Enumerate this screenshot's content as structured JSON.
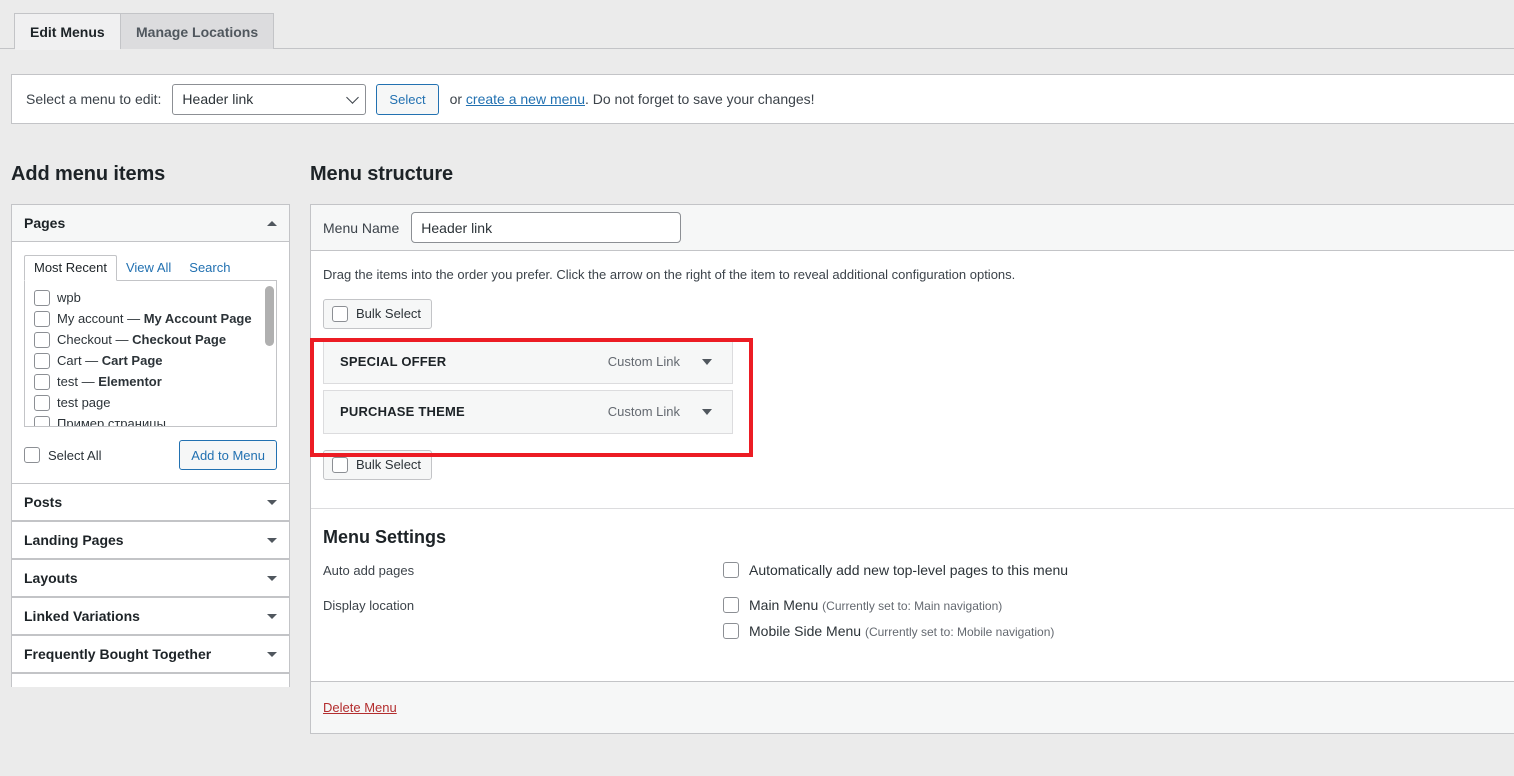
{
  "tabs": [
    {
      "label": "Edit Menus",
      "active": true
    },
    {
      "label": "Manage Locations",
      "active": false
    }
  ],
  "menu_selector": {
    "label": "Select a menu to edit:",
    "selected": "Header link",
    "options": [
      "Header link"
    ],
    "select_button": "Select",
    "or_text": "or ",
    "create_link": "create a new menu",
    "after_text": ". Do not forget to save your changes!"
  },
  "left": {
    "heading": "Add menu items",
    "pages_panel": {
      "title": "Pages",
      "tabs": [
        {
          "label": "Most Recent",
          "active": true
        },
        {
          "label": "View All",
          "active": false
        },
        {
          "label": "Search",
          "active": false
        }
      ],
      "items": [
        {
          "name": "wpb",
          "type": ""
        },
        {
          "name": "My account",
          "type": "My Account Page"
        },
        {
          "name": "Checkout",
          "type": "Checkout Page"
        },
        {
          "name": "Cart",
          "type": "Cart Page"
        },
        {
          "name": "test",
          "type": "Elementor"
        },
        {
          "name": "test page",
          "type": ""
        },
        {
          "name": "Пример страницы",
          "type": ""
        }
      ],
      "select_all": "Select All",
      "add_to_menu": "Add to Menu"
    },
    "sections": [
      {
        "title": "Posts"
      },
      {
        "title": "Landing Pages"
      },
      {
        "title": "Layouts"
      },
      {
        "title": "Linked Variations"
      },
      {
        "title": "Frequently Bought Together"
      }
    ]
  },
  "right": {
    "heading": "Menu structure",
    "menu_name_label": "Menu Name",
    "menu_name_value": "Header link",
    "hint": "Drag the items into the order you prefer. Click the arrow on the right of the item to reveal additional configuration options.",
    "bulk_select_top": "Bulk Select",
    "bulk_select_bottom": "Bulk Select",
    "menu_items": [
      {
        "title": "SPECIAL OFFER",
        "type": "Custom Link"
      },
      {
        "title": "PURCHASE THEME",
        "type": "Custom Link"
      }
    ],
    "settings": {
      "heading": "Menu Settings",
      "auto_add_label": "Auto add pages",
      "auto_add_option": "Automatically add new top-level pages to this menu",
      "display_location_label": "Display location",
      "locations": [
        {
          "name": "Main Menu",
          "note": "(Currently set to: Main navigation)"
        },
        {
          "name": "Mobile Side Menu",
          "note": "(Currently set to: Mobile navigation)"
        }
      ]
    },
    "delete_menu": "Delete Menu"
  },
  "colors": {
    "highlight": "#ec1c24",
    "link": "#2271b1",
    "danger": "#b32d2e",
    "page_bg": "#ebebeb"
  }
}
